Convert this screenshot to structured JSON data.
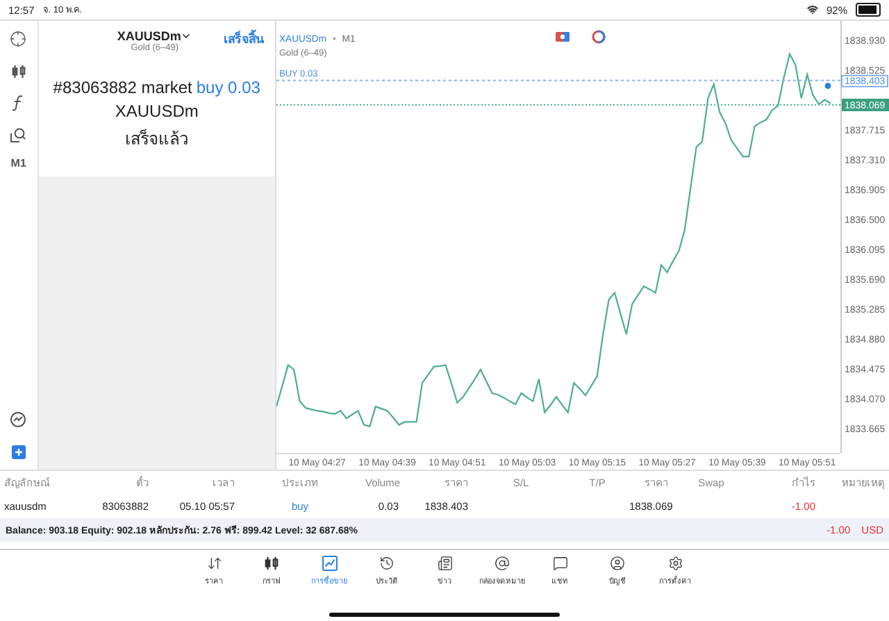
{
  "status_bar": {
    "time": "12:57",
    "date": "จ. 10 พ.ค.",
    "battery": "92%"
  },
  "left_toolbar": {
    "timeframe": "M1"
  },
  "order_panel": {
    "symbol": "XAUUSDm",
    "description": "Gold (6–49)",
    "done_link": "เสร็จสิ้น",
    "message": "#83063882 market",
    "message_highlight": "buy 0.03",
    "message_symbol": "XAUUSDm",
    "result": "เสร็จแล้ว"
  },
  "chart": {
    "symbol": "XAUUSDm",
    "separator": "•",
    "timeframe": "M1",
    "description": "Gold (6–49)",
    "price_tags": [
      {
        "kind": "order",
        "tag": "1838.403"
      },
      {
        "kind": "bid",
        "tag": "1838.069"
      }
    ],
    "chart_data": {
      "type": "line",
      "ylim": [
        1833.35,
        1839.21
      ],
      "ref_lines": [
        {
          "axis": "y",
          "value": 1838.403,
          "label": "BUY 0.03",
          "color": "#8ab4e8"
        },
        {
          "axis": "y",
          "value": 1838.069,
          "color": "#4caf8a"
        }
      ],
      "categories": [
        null,
        null,
        null,
        null,
        null,
        null,
        null,
        "10 May 04:27",
        null,
        null,
        null,
        null,
        null,
        null,
        null,
        null,
        null,
        null,
        null,
        "10 May 04:39",
        null,
        null,
        null,
        null,
        null,
        null,
        null,
        null,
        null,
        null,
        null,
        "10 May 04:51",
        null,
        null,
        null,
        null,
        null,
        null,
        null,
        null,
        null,
        null,
        null,
        "10 May 05:03",
        null,
        null,
        null,
        null,
        null,
        null,
        null,
        null,
        null,
        null,
        null,
        "10 May 05:15",
        null,
        null,
        null,
        null,
        null,
        null,
        null,
        null,
        null,
        null,
        null,
        "10 May 05:27",
        null,
        null,
        null,
        null,
        null,
        null,
        null,
        null,
        null,
        null,
        null,
        "10 May 05:39",
        null,
        null,
        null,
        null,
        null,
        null,
        null,
        null,
        null,
        null,
        null,
        "10 May 05:51",
        null,
        null,
        null,
        null
      ],
      "series": [
        {
          "color": "#4caf8a",
          "values": [
            1833.98,
            1834.26,
            1834.54,
            1834.48,
            1834.05,
            1833.96,
            1833.94,
            1833.92,
            1833.91,
            1833.89,
            1833.88,
            1833.92,
            1833.82,
            1833.87,
            1833.92,
            1833.73,
            1833.71,
            1833.98,
            1833.95,
            1833.92,
            1833.83,
            1833.73,
            1833.77,
            1833.77,
            1833.77,
            1834.3,
            1834.41,
            1834.52,
            1834.53,
            1834.54,
            1834.29,
            1834.03,
            1834.11,
            1834.23,
            1834.35,
            1834.48,
            1834.32,
            1834.16,
            1834.14,
            1834.1,
            1834.05,
            1834.01,
            1834.16,
            1834.1,
            1834.05,
            1834.35,
            1833.9,
            1834.0,
            1834.11,
            1834.0,
            1833.9,
            1834.3,
            1834.22,
            1834.13,
            1834.26,
            1834.39,
            1834.96,
            1835.43,
            1835.52,
            1835.24,
            1834.96,
            1835.37,
            1835.49,
            1835.61,
            1835.57,
            1835.52,
            1835.9,
            1835.8,
            1835.95,
            1836.09,
            1836.37,
            1836.94,
            1837.5,
            1837.57,
            1838.16,
            1838.35,
            1837.97,
            1837.82,
            1837.59,
            1837.48,
            1837.37,
            1837.37,
            1837.78,
            1837.83,
            1837.87,
            1838.0,
            1838.06,
            1838.44,
            1838.76,
            1838.61,
            1838.16,
            1838.48,
            1838.2,
            1838.08,
            1838.14,
            1838.09
          ]
        }
      ],
      "yticks": [
        {
          "value": 1838.93,
          "label": "1838.930"
        },
        {
          "value": 1838.525,
          "label": "1838.525"
        },
        {
          "value": 1837.715,
          "label": "1837.715"
        },
        {
          "value": 1837.31,
          "label": "1837.310"
        },
        {
          "value": 1836.905,
          "label": "1836.905"
        },
        {
          "value": 1836.5,
          "label": "1836.500"
        },
        {
          "value": 1836.095,
          "label": "1836.095"
        },
        {
          "value": 1835.69,
          "label": "1835.690"
        },
        {
          "value": 1835.285,
          "label": "1835.285"
        },
        {
          "value": 1834.88,
          "label": "1834.880"
        },
        {
          "value": 1834.475,
          "label": "1834.475"
        },
        {
          "value": 1834.07,
          "label": "1834.070"
        },
        {
          "value": 1833.665,
          "label": "1833.665"
        }
      ]
    }
  },
  "table": {
    "columns": [
      "สัญลักษณ์",
      "ตั๋ว",
      "เวลา",
      "ประเภท",
      "Volume",
      "ราคา",
      "S/L",
      "T/P",
      "ราคา",
      "Swap",
      "กำไร",
      "หมายเหตุ"
    ],
    "rows": [
      {
        "symbol": "xauusdm",
        "ticket": "83063882",
        "time": "05.10 05:57",
        "type": "buy",
        "volume": "0.03",
        "price": "1838.403",
        "current_price": "1838.069",
        "profit": "-1.00"
      }
    ],
    "summary": {
      "text": "Balance: 903.18 Equity: 902.18 หลักประกัน: 2.76 ฟรี: 899.42 Level: 32 687.68%",
      "profit": "-1.00",
      "currency": "USD"
    }
  },
  "bottom_nav": [
    {
      "label": "ราคา",
      "selected": false
    },
    {
      "label": "กราฟ",
      "selected": false
    },
    {
      "label": "การซื้อขาย",
      "selected": true
    },
    {
      "label": "ประวัติ",
      "selected": false
    },
    {
      "label": "ข่าว",
      "selected": false
    },
    {
      "label": "กล่องจดหมาย",
      "selected": false
    },
    {
      "label": "แชท",
      "selected": false
    },
    {
      "label": "บัญชี",
      "selected": false
    },
    {
      "label": "การตั้งค่า",
      "selected": false
    }
  ]
}
